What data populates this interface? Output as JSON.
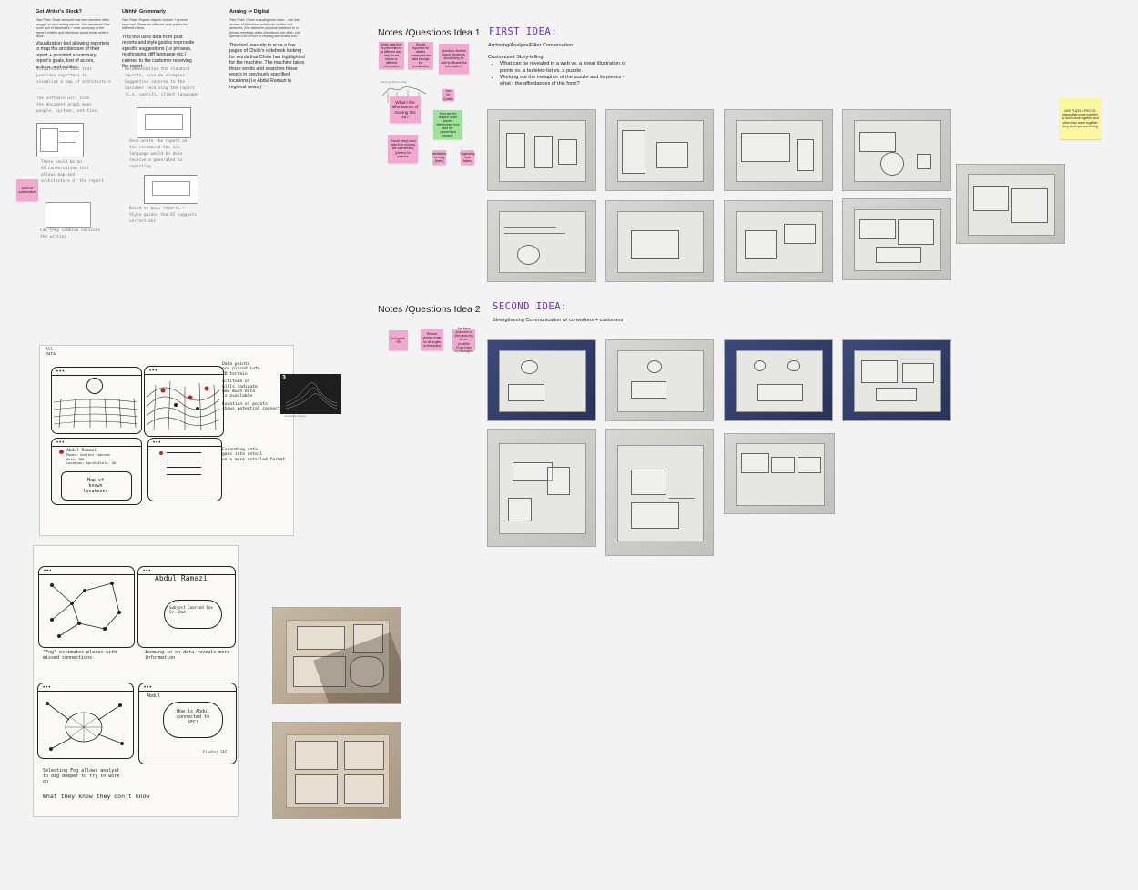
{
  "left_columns": [
    {
      "title": "Got Writer's Block?",
      "pain_point": "Pain Point: Susie stressed that new reporters often struggle to start writing reports. She mentioned that some sort of framework + clear summary of the report's entities and intentions would break writer's block.",
      "description": "Visualization tool allowing reporters to map the architecture of their report + provided a summary report's goals, lost of actors, actions, and entities."
    },
    {
      "title": "Uhhhh Grammarly",
      "pain_point": "Pain Point: Reports require concise + precise language. There are different style guides for different clients.",
      "description": "This tool uses data from past reports and style guides to provide specific suggestions (i.e phrases, re-phrasing, diff language etc.) catered to the customer receiving the report."
    },
    {
      "title": "Analog -> Digital",
      "pain_point": "Pain Point: Chloe is analog note-taker... she has dozens of Moleskine notebooks stuffed with sketches. She takes her physical notebook to in person meetings when she returns her desk. she spends a lot of time re-reading and finding info.",
      "description": "This tool uses nlp to scan a few pages of Chole's notebook looking for words that Chole has highlighted for the machine. The machine takes those words and searches those words in previously specified locations (i.e Abdul Ramazi in regional news.)"
    }
  ],
  "handwriting": {
    "col1": [
      "Visualization tool that",
      "provides reporters to",
      "visualize a map of architecture",
      "...",
      "The software will scan",
      "the document graph maps",
      "people, systems, entities.",
      "",
      "These could be an",
      "AI conversation that",
      "allows map and",
      "architecture of the report",
      "",
      "Can they combine sections",
      "the writing"
    ],
    "col2": [
      "Recommendation the standard",
      "reports, provide examples",
      "Suggestion catered to the",
      "customer receiving the report",
      "(i.e. specific client language)",
      "",
      "Once wrote the report on",
      "the recommend the new",
      "language would be done",
      "receive a generated to",
      "reporting",
      "",
      "Based on past reports +",
      "Style guides the AI suggests",
      "corrections"
    ]
  },
  "sticky_collaboration": "could be collaborative",
  "idea1": {
    "header": "Notes /Questions Idea 1",
    "title": "FIRST IDEA:",
    "subtitle": "Archiving/Analyze/Filter Conversation",
    "sub2": "Customized Story-telling",
    "bullets": [
      "What can be revealed in a web vs. a linear illustration of points vs. a bulleted-list vs. a puzzle.",
      "Working out the metaphor of the puzzle  and its pieces - what r the affordances of this form?"
    ],
    "stickies": [
      "Does data that is presented in a different way help reveal trends or different information",
      "Should reporters be able to manipulate the data through the visualization",
      "Question: Multiple layout structures should they be able to reframe the information?",
      "What r the affordances of making this 3d?",
      "Use for Quality",
      "How are the shapes of the pieces determined, how and the connections shown?",
      "Should (they) want data from sources like intersecting (pieces) for patterns",
      "Interlinked: forming (them)",
      "Organizing data tables"
    ],
    "diagram_label": "Analog Notes-map"
  },
  "puzzle_note": "LIKE PUZZLE PIECES: pieces that come together or don't come together and when they come together they show you something",
  "idea2": {
    "header": "Notes /Questions Idea 2",
    "title": "SECOND IDEA:",
    "subtitle": "Strengthening Communication w/ co-workers + customers",
    "stickies": [
      "hologram +3D",
      "Reduce precise scale for all angles of interaction",
      "Are there problems to (be) reducing by the possible Fixes (new to) Managers"
    ]
  },
  "top_sketch": {
    "notes_a": [
      "Data points",
      "are placed into",
      "3D terrain",
      "",
      "Altitude of",
      "hills indicate",
      "how much data",
      "is available",
      "",
      "Location of points",
      "shows potential connections"
    ],
    "notes_b": [
      "Expanding data",
      "goes into detail",
      "on a more detailed format"
    ],
    "corner_label": "All data",
    "person_label": "Abdul Ramazi",
    "person_lines": [
      "Power: Subject Coerced",
      "Date: 26K",
      "Location: Springfield, VA"
    ],
    "map_label": [
      "Map of",
      "known locations"
    ],
    "vis_badge": "3",
    "vis_caption": "visualization concept"
  },
  "bottom_sketch": {
    "title_b": "Abdul Ramazi",
    "cloud_b": "Subject Coerced Fox Sr. Dad",
    "cap_a": "\"Fog\" estimates places with missed connections",
    "cap_b": "Zooming in on data reveals more information",
    "label_c": "Abdul",
    "cloud_c": "How is Abdul connected to SFC?",
    "note_c": "Finding SFC",
    "cap_c": "Selecting Fog allows analyst to dig deeper to try to work on",
    "cap_c2": "What they know they don't know"
  }
}
